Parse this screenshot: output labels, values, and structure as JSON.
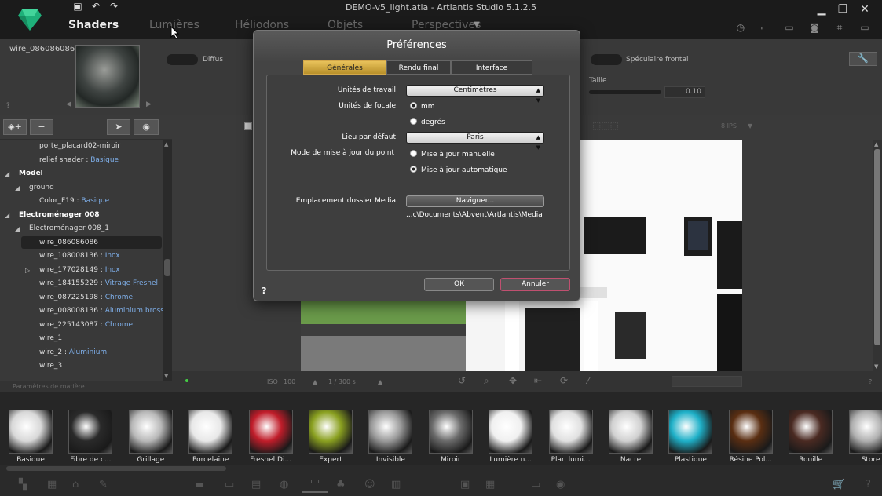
{
  "app": {
    "window_title": "DEMO-v5_light.atla - Artlantis Studio 5.1.2.5",
    "main_tabs": [
      "Shaders",
      "Lumières",
      "Héliodons",
      "Objets",
      "Perspectives"
    ],
    "quick_access": [
      "save-icon",
      "undo-icon",
      "redo-icon"
    ],
    "window_controls": [
      "minimize-icon",
      "restore-icon",
      "close-icon"
    ]
  },
  "shader_panel": {
    "material_name": "wire_086086086",
    "help": "?",
    "diffus_label": "Diffus",
    "specular_label": "Spéculaire frontal",
    "taille_label": "Taille",
    "taille_value": "0.10"
  },
  "tree": {
    "rows": [
      {
        "text": "porte_placard02-miroir",
        "mat": "",
        "arrow": "",
        "indent": 50,
        "bold": false,
        "sel": false
      },
      {
        "text": "relief shader : ",
        "mat": "Basique",
        "arrow": "",
        "indent": 50,
        "bold": false,
        "sel": false
      },
      {
        "text": "Model",
        "mat": "",
        "arrow": "◢",
        "indent": 24,
        "bold": true,
        "sel": false
      },
      {
        "text": "ground",
        "mat": "",
        "arrow": "◢",
        "indent": 37,
        "bold": false,
        "sel": false
      },
      {
        "text": "Color_F19 : ",
        "mat": "Basique",
        "arrow": "",
        "indent": 50,
        "bold": false,
        "sel": false
      },
      {
        "text": "Electroménager 008",
        "mat": "",
        "arrow": "◢",
        "indent": 24,
        "bold": true,
        "sel": false
      },
      {
        "text": "Electroménager 008_1",
        "mat": "",
        "arrow": "◢",
        "indent": 37,
        "bold": false,
        "sel": false
      },
      {
        "text": "wire_086086086",
        "mat": "",
        "arrow": "",
        "indent": 50,
        "bold": false,
        "sel": true
      },
      {
        "text": "wire_108008136 : ",
        "mat": "Inox",
        "arrow": "",
        "indent": 50,
        "bold": false,
        "sel": false
      },
      {
        "text": "wire_177028149 : ",
        "mat": "Inox",
        "arrow": "▷",
        "indent": 50,
        "bold": false,
        "sel": false
      },
      {
        "text": "wire_184155229 : ",
        "mat": "Vitrage Fresnel",
        "arrow": "",
        "indent": 50,
        "bold": false,
        "sel": false
      },
      {
        "text": "wire_087225198 : ",
        "mat": "Chrome",
        "arrow": "",
        "indent": 50,
        "bold": false,
        "sel": false
      },
      {
        "text": "wire_008008136 : ",
        "mat": "Aluminium bross",
        "arrow": "",
        "indent": 50,
        "bold": false,
        "sel": false
      },
      {
        "text": "wire_225143087 : ",
        "mat": "Chrome",
        "arrow": "",
        "indent": 50,
        "bold": false,
        "sel": false
      },
      {
        "text": "wire_1",
        "mat": "",
        "arrow": "",
        "indent": 50,
        "bold": false,
        "sel": false
      },
      {
        "text": "wire_2 : ",
        "mat": "Aluminium",
        "arrow": "",
        "indent": 50,
        "bold": false,
        "sel": false
      },
      {
        "text": "wire_3",
        "mat": "",
        "arrow": "",
        "indent": 50,
        "bold": false,
        "sel": false
      }
    ],
    "footer": "Paramètres de matière"
  },
  "viewport": {
    "iso_label": "ISO",
    "iso_value": "100",
    "shutter": "1 / 300 s",
    "fps": "8 IPS"
  },
  "catalog": {
    "items": [
      "Basique",
      "Fibre de c...",
      "Grillage",
      "Porcelaine",
      "Fresnel Di...",
      "Expert",
      "Invisible",
      "Miroir",
      "Lumière n...",
      "Plan lumi...",
      "Nacre",
      "Plastique",
      "Résine Pol...",
      "Rouille",
      "Store"
    ],
    "colors": [
      "#d8d8d8",
      "#2a2a2a",
      "#b8b8b8",
      "#e8e8e8",
      "#c01d2a",
      "#8aa020",
      "#9a9a9a",
      "#6a6a6a",
      "#f0f0f0",
      "#e0e0e0",
      "#d0d0d0",
      "#1fb0c8",
      "#5a2e12",
      "#4a2a22",
      "#b0b0b0"
    ]
  },
  "dialog": {
    "title": "Préférences",
    "tabs": [
      "Générales",
      "Rendu final",
      "Interface"
    ],
    "unites_travail_label": "Unités de travail",
    "unites_travail_value": "Centimètres",
    "unites_focale_label": "Unités de focale",
    "focale_options": [
      "mm",
      "degrés"
    ],
    "lieu_label": "Lieu par défaut",
    "lieu_value": "Paris",
    "mode_label": "Mode de mise à jour du point",
    "mode_options": [
      "Mise à jour manuelle",
      "Mise à jour automatique"
    ],
    "media_label": "Emplacement dossier Media",
    "naviguer": "Naviguer...",
    "media_path": "...c\\Documents\\Abvent\\Artlantis\\Media",
    "ok": "OK",
    "annuler": "Annuler",
    "help": "?"
  }
}
